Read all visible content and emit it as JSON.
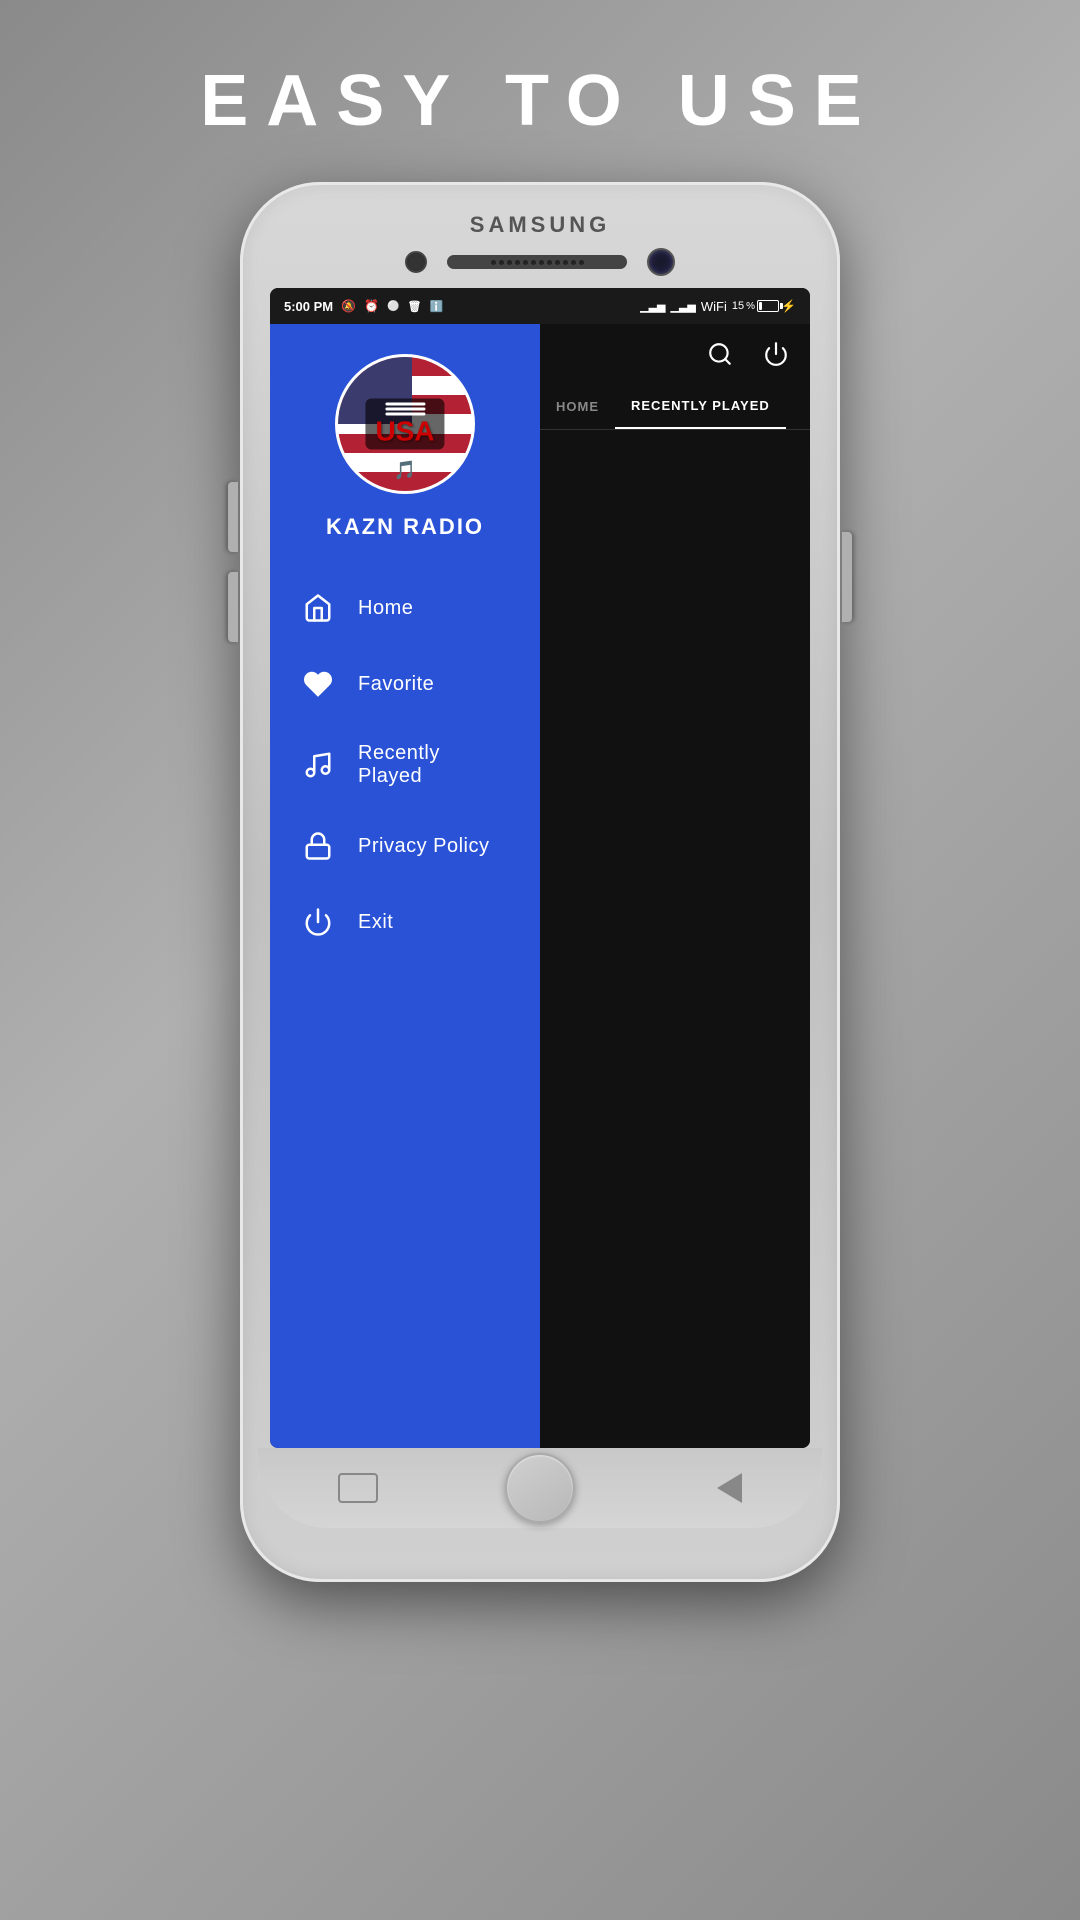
{
  "page": {
    "headline": "EASY TO USE"
  },
  "statusBar": {
    "time": "5:00 PM",
    "battery": "15"
  },
  "samsung": {
    "brand": "SAMSUNG"
  },
  "app": {
    "logoText": "USA",
    "name": "KAZN RADIO"
  },
  "toolbar": {
    "searchLabel": "search",
    "powerLabel": "power"
  },
  "tabs": [
    {
      "label": "HOME",
      "active": false
    },
    {
      "label": "RECENTLY PLAYED",
      "active": true
    }
  ],
  "nav": {
    "items": [
      {
        "id": "home",
        "label": "Home",
        "icon": "home"
      },
      {
        "id": "favorite",
        "label": "Favorite",
        "icon": "heart"
      },
      {
        "id": "recently-played",
        "label": "Recently Played",
        "icon": "music"
      },
      {
        "id": "privacy-policy",
        "label": "Privacy Policy",
        "icon": "lock"
      },
      {
        "id": "exit",
        "label": "Exit",
        "icon": "power"
      }
    ]
  }
}
